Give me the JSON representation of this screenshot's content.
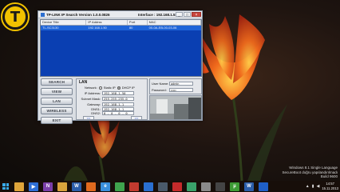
{
  "logo": {
    "letter": "T"
  },
  "app": {
    "title": "TP-LINK IP Search Version 1.0.0.0826",
    "interface_label": "Interface : 192.168.1.51",
    "window_buttons": {
      "minimize": "_",
      "maximize": "□",
      "close": "×"
    },
    "table": {
      "columns": [
        "Device Title",
        "IP Addrss",
        "Port",
        "MAC"
      ],
      "rows": [
        {
          "title": "TL-SC3130",
          "ip": "192.168.1.50",
          "port": "80",
          "mac": "00-0A-EB-00-03-06"
        }
      ]
    },
    "nav": [
      {
        "key": "search",
        "label": "SEARCH"
      },
      {
        "key": "view",
        "label": "VIEW"
      },
      {
        "key": "lan",
        "label": "LAN"
      },
      {
        "key": "wireless",
        "label": "WIRELESS"
      },
      {
        "key": "exit",
        "label": "EXIT"
      }
    ],
    "lan": {
      "title": "LAN",
      "network_label": "Network:",
      "static_ip_label": "Static IP",
      "dhcp_label": "DHCP IP",
      "selected_mode": "dhcp",
      "fields": [
        {
          "label": "IP Address:",
          "value": "192.168.1.50"
        },
        {
          "label": "Subnet Mask:",
          "value": "255.255.255.0"
        },
        {
          "label": "Gateway:",
          "value": "192.168.1.1"
        },
        {
          "label": "DNS1:",
          "value": "192.168.1.1"
        },
        {
          "label": "DNS2:",
          "value": "0 . 0 . 0 . 0"
        }
      ],
      "prev_label": "<<",
      "next_label": ">>"
    },
    "login": {
      "username_label": "User Name:",
      "username_value": "admin",
      "password_label": "Password:",
      "password_value": "•••••"
    }
  },
  "watermark": {
    "line1": "Windows 8.1 Single Language",
    "line2": "SecureBoot doğru yapılandırılmadı",
    "line3": "Build 9600"
  },
  "taskbar": {
    "icons": [
      {
        "name": "file-explorer-icon",
        "glyph": "",
        "color": "#e0a43a"
      },
      {
        "name": "media-player-icon",
        "glyph": "▶",
        "color": "#2f6fd6"
      },
      {
        "name": "onenote-icon",
        "glyph": "N",
        "color": "#7b3fa8"
      },
      {
        "name": "folder-icon",
        "glyph": "",
        "color": "#d8a23c"
      },
      {
        "name": "word-icon",
        "glyph": "W",
        "color": "#2b5eaa"
      },
      {
        "name": "firefox-icon",
        "glyph": "",
        "color": "#e06a1e"
      },
      {
        "name": "ie-icon",
        "glyph": "e",
        "color": "#3a8fdc"
      },
      {
        "name": "chrome-icon",
        "glyph": "",
        "color": "#3fa34d"
      },
      {
        "name": "flag-icon",
        "glyph": "",
        "color": "#c23b2f"
      },
      {
        "name": "teamviewer-icon",
        "glyph": "",
        "color": "#2a6fd0"
      },
      {
        "name": "settings-icon",
        "glyph": "",
        "color": "#4a5a6a"
      },
      {
        "name": "app-red-icon",
        "glyph": "",
        "color": "#c42b2b"
      },
      {
        "name": "store-icon",
        "glyph": "",
        "color": "#3aa26a"
      },
      {
        "name": "app-grey-icon",
        "glyph": "",
        "color": "#8a8a8a"
      },
      {
        "name": "camera-icon",
        "glyph": "",
        "color": "#444"
      },
      {
        "name": "utorrent-icon",
        "glyph": "µ",
        "color": "#3d9b35"
      },
      {
        "name": "word2-icon",
        "glyph": "W",
        "color": "#2b5eaa"
      },
      {
        "name": "tp-search-icon",
        "glyph": "",
        "color": "#1f5fc7"
      }
    ],
    "time": "14:57",
    "date": "15.11.2013"
  }
}
